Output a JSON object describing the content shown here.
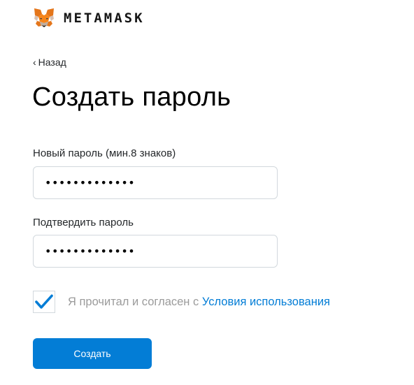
{
  "brand": {
    "name": "METAMASK",
    "logo_icon": "metamask-fox-icon"
  },
  "nav": {
    "back_label": "Назад",
    "back_icon": "chevron-left-icon"
  },
  "page": {
    "title": "Создать пароль"
  },
  "form": {
    "new_password": {
      "label": "Новый пароль (мин.8 знаков)",
      "value": "•••••••••••••"
    },
    "confirm_password": {
      "label": "Подтвердить пароль",
      "value": "•••••••••••••"
    },
    "terms": {
      "checked": true,
      "check_icon": "checkmark-icon",
      "text": "Я прочитал и согласен с",
      "link_text": "Условия использования"
    },
    "submit_label": "Создать"
  },
  "colors": {
    "primary": "#037dd6",
    "text": "#24272a",
    "muted_text": "#9b9b9b",
    "input_border": "#d2d8dd",
    "fox_orange": "#e2761b"
  }
}
